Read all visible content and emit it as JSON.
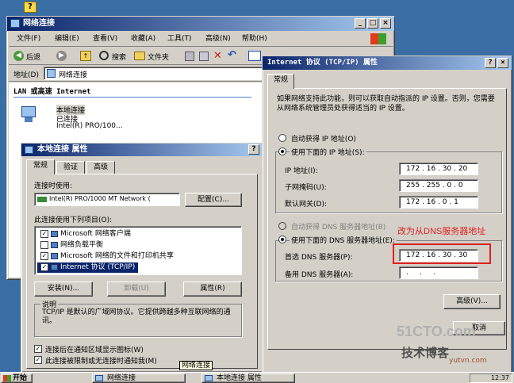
{
  "explorer": {
    "title": "网络连接",
    "menu": [
      "文件(F)",
      "编辑(E)",
      "查看(V)",
      "收藏(A)",
      "工具(T)",
      "高级(N)",
      "帮助(H)"
    ],
    "toolbar": {
      "back": "后退",
      "search": "搜索",
      "folders": "文件夹"
    },
    "address_label": "地址(D)",
    "address_value": "网络连接",
    "section_header": "LAN 或高速 Internet",
    "connection": {
      "name": "本地连接",
      "status": "已连接",
      "device": "Intel(R) PRO/100..."
    }
  },
  "local_props": {
    "title": "本地连接 属性",
    "tabs": [
      "常规",
      "验证",
      "高级"
    ],
    "connect_using_label": "连接时使用:",
    "adapter": "Intel(R) PRO/1000 MT Network (",
    "configure_button": "配置(C)...",
    "items_label": "此连接使用下列项目(O):",
    "items": [
      {
        "label": "Microsoft 网络客户端",
        "checked": true
      },
      {
        "label": "网络负载平衡",
        "checked": false
      },
      {
        "label": "Microsoft 网络的文件和打印机共享",
        "checked": true
      },
      {
        "label": "Internet 协议 (TCP/IP)",
        "checked": true
      }
    ],
    "install_button": "安装(N)...",
    "uninstall_button": "卸载(U)",
    "properties_button": "属性(R)",
    "desc_title": "说明",
    "description": "TCP/IP 是默认的广域网协议。它提供跨越多种互联网络的通讯。",
    "show_icon_label": "连接后在通知区域显示图标(W)",
    "notify_label": "此连接被限制或无连接时通知我(M)"
  },
  "tcpip": {
    "title": "Internet 协议 (TCP/IP) 属性",
    "tab": "常规",
    "intro": "如果网络支持此功能，则可以获取自动指派的 IP 设置。否则，您需要从网络系统管理员处获得适当的 IP 设置。",
    "auto_ip": "自动获得 IP 地址(O)",
    "manual_ip": "使用下面的 IP 地址(S):",
    "ip_label": "IP 地址(I):",
    "ip_value": "172 . 16 . 30 . 20",
    "mask_label": "子网掩码(U):",
    "mask_value": "255 . 255 . 0 . 0",
    "gateway_label": "默认网关(D):",
    "gateway_value": "172 . 16 . 0 . 1",
    "auto_dns": "自动获得 DNS 服务器地址(B)",
    "manual_dns": "使用下面的 DNS 服务器地址(E):",
    "pref_dns_label": "首选 DNS 服务器(P):",
    "pref_dns_value": "172 . 16 . 30 . 30",
    "alt_dns_label": "备用 DNS 服务器(A):",
    "alt_dns_value": ".     .     .",
    "advanced_button": "高级(V)...",
    "cancel_button": "取消"
  },
  "annotation": "改为从DNS服务器地址",
  "tooltip": "网络连接",
  "taskbar": {
    "start": "开始",
    "tasks": [
      "网络连接",
      "本地连接 属性"
    ],
    "clock": "12:37"
  },
  "watermark": {
    "line1": "51CTO.com",
    "line2": "技术博客",
    "line3": "yutvn.com"
  },
  "colors": {
    "title_active": "#0a246a",
    "desktop": "#3a6ea5",
    "highlight": "#e02020"
  }
}
